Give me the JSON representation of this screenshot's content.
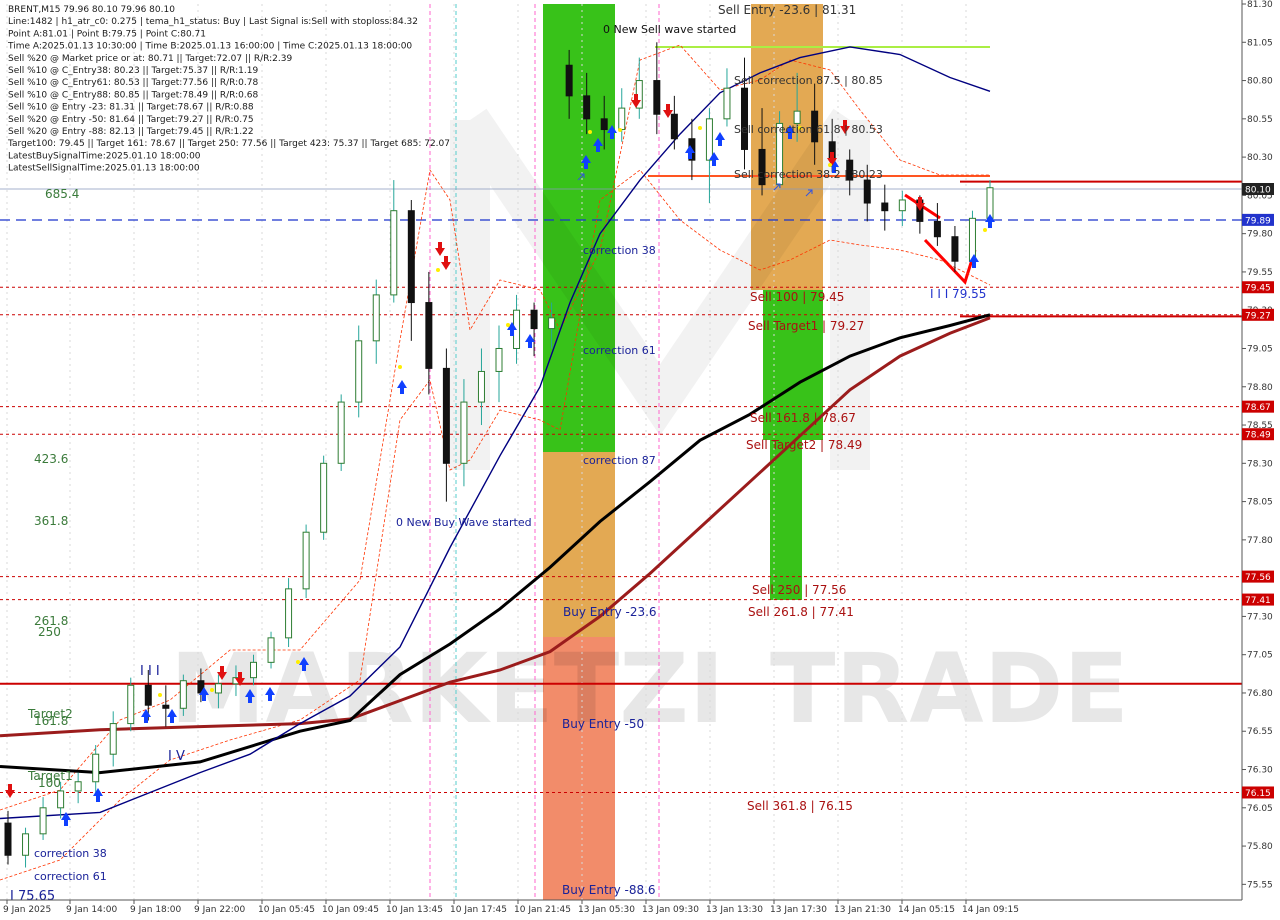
{
  "header": {
    "lines": [
      "BRENT,M15  79.96 80.10 79.96 80.10",
      "Line:1482 | h1_atr_c0: 0.275 | tema_h1_status: Buy | Last Signal is:Sell with stoploss:84.32",
      "Point A:81.01 | Point B:79.75 | Point C:80.71",
      "Time A:2025.01.13 10:30:00 | Time B:2025.01.13 16:00:00 | Time C:2025.01.13 18:00:00",
      "Sell %20 @ Market price or at: 80.71 || Target:72.07 || R/R:2.39",
      "Sell %10 @ C_Entry38: 80.23 || Target:75.37 || R/R:1.19",
      "Sell %10 @ C_Entry61: 80.53 || Target:77.56 || R/R:0.78",
      "Sell %10 @ C_Entry88: 80.85 || Target:78.49 || R/R:0.68",
      "Sell %10 @ Entry -23: 81.31 || Target:78.67 || R/R:0.88",
      "Sell %20 @ Entry -50: 81.64 || Target:79.27 || R/R:0.75",
      "Sell %20 @ Entry -88: 82.13 || Target:79.45 || R/R:1.22",
      "Target100: 79.45 || Target 161: 78.67 || Target 250: 77.56 || Target 423: 75.37 || Target 685: 72.07",
      "LatestBuySignalTime:2025.01.10 18:00:00",
      "LatestSellSignalTime:2025.01.13 18:00:00"
    ]
  },
  "watermark": {
    "bold": "MARKETZI",
    "light": "TRADE"
  },
  "colors": {
    "up": "#26a69a",
    "up_body": "#2e7d32",
    "down": "#111111",
    "zone_green": "#22bb00",
    "zone_orange": "#e0a040",
    "zone_salmon": "#f07850",
    "level_red": "#cc0000",
    "ma_black": "#000000",
    "ma_darkred": "#9b1c1c",
    "ma_blue": "#000080",
    "arrow_blue": "#1040ff",
    "arrow_red": "#e01010",
    "price_tag": "#222222",
    "blue_tag": "#2233cc"
  },
  "chart_data": {
    "type": "candlestick",
    "symbol": "BRENT,M15",
    "ylim": [
      75.5,
      81.3
    ],
    "y_ticks": [
      81.3,
      81.05,
      80.8,
      80.55,
      80.3,
      80.05,
      79.8,
      79.55,
      79.3,
      79.05,
      78.8,
      78.55,
      78.3,
      78.05,
      77.8,
      77.55,
      77.3,
      77.05,
      76.8,
      76.55,
      76.3,
      76.05,
      75.8,
      75.55
    ],
    "x_ticks": [
      "9 Jan 2025",
      "9 Jan 14:00",
      "9 Jan 18:00",
      "9 Jan 22:00",
      "10 Jan 05:45",
      "10 Jan 09:45",
      "10 Jan 13:45",
      "10 Jan 17:45",
      "10 Jan 21:45",
      "13 Jan 05:30",
      "13 Jan 09:30",
      "13 Jan 13:30",
      "13 Jan 17:30",
      "13 Jan 21:30",
      "14 Jan 05:15",
      "14 Jan 09:15"
    ],
    "current_price": "80.10",
    "price_tags": [
      {
        "value": 79.89,
        "text": "79.89",
        "style": "blue"
      },
      {
        "value": 79.45,
        "text": "79.45",
        "style": "red"
      },
      {
        "value": 79.27,
        "text": "79.27",
        "style": "red"
      },
      {
        "value": 78.67,
        "text": "78.67",
        "style": "red"
      },
      {
        "value": 78.49,
        "text": "78.49",
        "style": "red"
      },
      {
        "value": 77.56,
        "text": "77.56",
        "style": "red"
      },
      {
        "value": 77.41,
        "text": "77.41",
        "style": "red"
      },
      {
        "value": 76.15,
        "text": "76.15",
        "style": "red"
      }
    ],
    "levels": [
      {
        "value": 79.45,
        "style": "dotted"
      },
      {
        "value": 79.27,
        "style": "dotted"
      },
      {
        "value": 78.67,
        "style": "dotted"
      },
      {
        "value": 78.49,
        "style": "dotted"
      },
      {
        "value": 77.56,
        "style": "dotted"
      },
      {
        "value": 77.41,
        "style": "dotted"
      },
      {
        "value": 76.15,
        "style": "dotted"
      },
      {
        "value": 76.86,
        "style": "solid"
      },
      {
        "value": 80.14,
        "style": "solid-right"
      },
      {
        "value": 79.26,
        "style": "solid-right"
      }
    ],
    "zone_labels": [
      "0 New Sell wave started",
      "Sell Entry -23.6 | 81.31",
      "Sell correction 87.5 | 80.85",
      "Sell correction 61.8 | 80.53",
      "Sell correction 38.2 | 80.23",
      "correction 38",
      "correction 61",
      "correction 87",
      "0 New Buy Wave started",
      "Buy Entry -23.6",
      "Buy Entry -50",
      "Buy Entry -88.6",
      "Sell 100 | 79.45",
      "Sell Target1 | 79.27",
      "Sell 161.8 | 78.67",
      "Sell Target2 | 78.49",
      "Sell 250 | 77.56",
      "Sell 261.8 | 77.41",
      "Sell 361.8 | 76.15",
      "I I I 79.55"
    ],
    "left_labels": [
      "685.4",
      "423.6",
      "361.8",
      "261.8",
      "250",
      "Target2",
      "161.8",
      "Target1",
      "100",
      "correction 38",
      "correction 61",
      "I 75.65",
      "I I I",
      "I V"
    ],
    "series": [
      {
        "name": "candles",
        "values": [
          [
            75.95,
            76.03,
            75.68,
            75.74
          ],
          [
            75.74,
            75.92,
            75.66,
            75.88
          ],
          [
            75.88,
            76.12,
            75.84,
            76.05
          ],
          [
            76.05,
            76.22,
            75.98,
            76.16
          ],
          [
            76.16,
            76.28,
            76.08,
            76.22
          ],
          [
            76.22,
            76.46,
            76.15,
            76.4
          ],
          [
            76.4,
            76.68,
            76.32,
            76.6
          ],
          [
            76.6,
            76.9,
            76.55,
            76.85
          ],
          [
            76.85,
            76.95,
            76.62,
            76.72
          ],
          [
            76.72,
            76.85,
            76.58,
            76.7
          ],
          [
            76.7,
            76.92,
            76.65,
            76.88
          ],
          [
            76.88,
            76.96,
            76.74,
            76.8
          ],
          [
            76.8,
            76.92,
            76.7,
            76.86
          ],
          [
            76.86,
            76.98,
            76.78,
            76.9
          ],
          [
            76.9,
            77.05,
            76.85,
            77.0
          ],
          [
            77.0,
            77.2,
            76.96,
            77.16
          ],
          [
            77.16,
            77.55,
            77.1,
            77.48
          ],
          [
            77.48,
            77.9,
            77.42,
            77.85
          ],
          [
            77.85,
            78.35,
            77.8,
            78.3
          ],
          [
            78.3,
            78.75,
            78.25,
            78.7
          ],
          [
            78.7,
            79.2,
            78.6,
            79.1
          ],
          [
            79.1,
            79.5,
            78.95,
            79.4
          ],
          [
            79.4,
            80.15,
            79.35,
            79.95
          ],
          [
            79.95,
            80.02,
            79.1,
            79.35
          ],
          [
            79.35,
            79.55,
            78.75,
            78.92
          ],
          [
            78.92,
            79.05,
            78.05,
            78.3
          ],
          [
            78.3,
            78.85,
            78.15,
            78.7
          ],
          [
            78.7,
            79.05,
            78.55,
            78.9
          ],
          [
            78.9,
            79.2,
            78.7,
            79.05
          ],
          [
            79.05,
            79.4,
            78.95,
            79.3
          ],
          [
            79.3,
            79.35,
            79.0,
            79.18
          ],
          [
            79.18,
            79.35,
            79.05,
            79.25
          ],
          [
            80.9,
            81.0,
            80.55,
            80.7
          ],
          [
            80.7,
            80.85,
            80.45,
            80.55
          ],
          [
            80.55,
            80.7,
            80.35,
            80.48
          ],
          [
            80.48,
            80.75,
            80.4,
            80.62
          ],
          [
            80.62,
            80.95,
            80.55,
            80.8
          ],
          [
            80.8,
            81.05,
            80.45,
            80.58
          ],
          [
            80.58,
            80.7,
            80.35,
            80.42
          ],
          [
            80.42,
            80.55,
            80.15,
            80.28
          ],
          [
            80.28,
            80.62,
            80.0,
            80.55
          ],
          [
            80.55,
            80.88,
            80.5,
            80.75
          ],
          [
            80.75,
            80.95,
            80.22,
            80.35
          ],
          [
            80.35,
            80.62,
            80.05,
            80.12
          ],
          [
            80.12,
            80.6,
            80.1,
            80.52
          ],
          [
            80.52,
            80.85,
            80.4,
            80.6
          ],
          [
            80.6,
            80.78,
            80.25,
            80.4
          ],
          [
            80.4,
            80.55,
            80.2,
            80.28
          ],
          [
            80.28,
            80.35,
            80.05,
            80.15
          ],
          [
            80.15,
            80.25,
            79.88,
            80.0
          ],
          [
            80.0,
            80.12,
            79.82,
            79.95
          ],
          [
            79.95,
            80.08,
            79.85,
            80.02
          ],
          [
            80.02,
            80.05,
            79.8,
            79.88
          ],
          [
            79.88,
            80.0,
            79.72,
            79.78
          ],
          [
            79.78,
            79.85,
            79.55,
            79.62
          ],
          [
            79.62,
            79.95,
            79.58,
            79.9
          ],
          [
            79.9,
            80.15,
            79.85,
            80.1
          ]
        ]
      },
      {
        "name": "ma200",
        "values": [
          [
            0,
            76.32
          ],
          [
            100,
            76.28
          ],
          [
            200,
            76.35
          ],
          [
            300,
            76.55
          ],
          [
            350,
            76.62
          ],
          [
            400,
            76.92
          ],
          [
            450,
            77.12
          ],
          [
            500,
            77.35
          ],
          [
            550,
            77.62
          ],
          [
            600,
            77.92
          ],
          [
            650,
            78.18
          ],
          [
            700,
            78.45
          ],
          [
            750,
            78.62
          ],
          [
            800,
            78.83
          ],
          [
            850,
            79.0
          ],
          [
            900,
            79.12
          ],
          [
            950,
            79.2
          ],
          [
            990,
            79.27
          ]
        ]
      },
      {
        "name": "ma_red",
        "values": [
          [
            0,
            76.52
          ],
          [
            100,
            76.56
          ],
          [
            200,
            76.58
          ],
          [
            300,
            76.6
          ],
          [
            350,
            76.63
          ],
          [
            400,
            76.75
          ],
          [
            450,
            76.87
          ],
          [
            500,
            76.95
          ],
          [
            550,
            77.07
          ],
          [
            600,
            77.3
          ],
          [
            650,
            77.58
          ],
          [
            700,
            77.88
          ],
          [
            750,
            78.18
          ],
          [
            800,
            78.48
          ],
          [
            850,
            78.78
          ],
          [
            900,
            79.0
          ],
          [
            950,
            79.15
          ],
          [
            990,
            79.25
          ]
        ]
      },
      {
        "name": "ma_blue",
        "values": [
          [
            0,
            75.98
          ],
          [
            100,
            76.02
          ],
          [
            150,
            76.15
          ],
          [
            200,
            76.28
          ],
          [
            250,
            76.4
          ],
          [
            300,
            76.6
          ],
          [
            350,
            76.78
          ],
          [
            400,
            77.1
          ],
          [
            450,
            77.75
          ],
          [
            500,
            78.35
          ],
          [
            540,
            78.8
          ],
          [
            570,
            79.35
          ],
          [
            600,
            79.8
          ],
          [
            640,
            80.15
          ],
          [
            680,
            80.45
          ],
          [
            720,
            80.72
          ],
          [
            760,
            80.85
          ],
          [
            800,
            80.95
          ],
          [
            850,
            81.02
          ],
          [
            900,
            80.97
          ],
          [
            950,
            80.82
          ],
          [
            990,
            80.73
          ]
        ]
      }
    ]
  }
}
